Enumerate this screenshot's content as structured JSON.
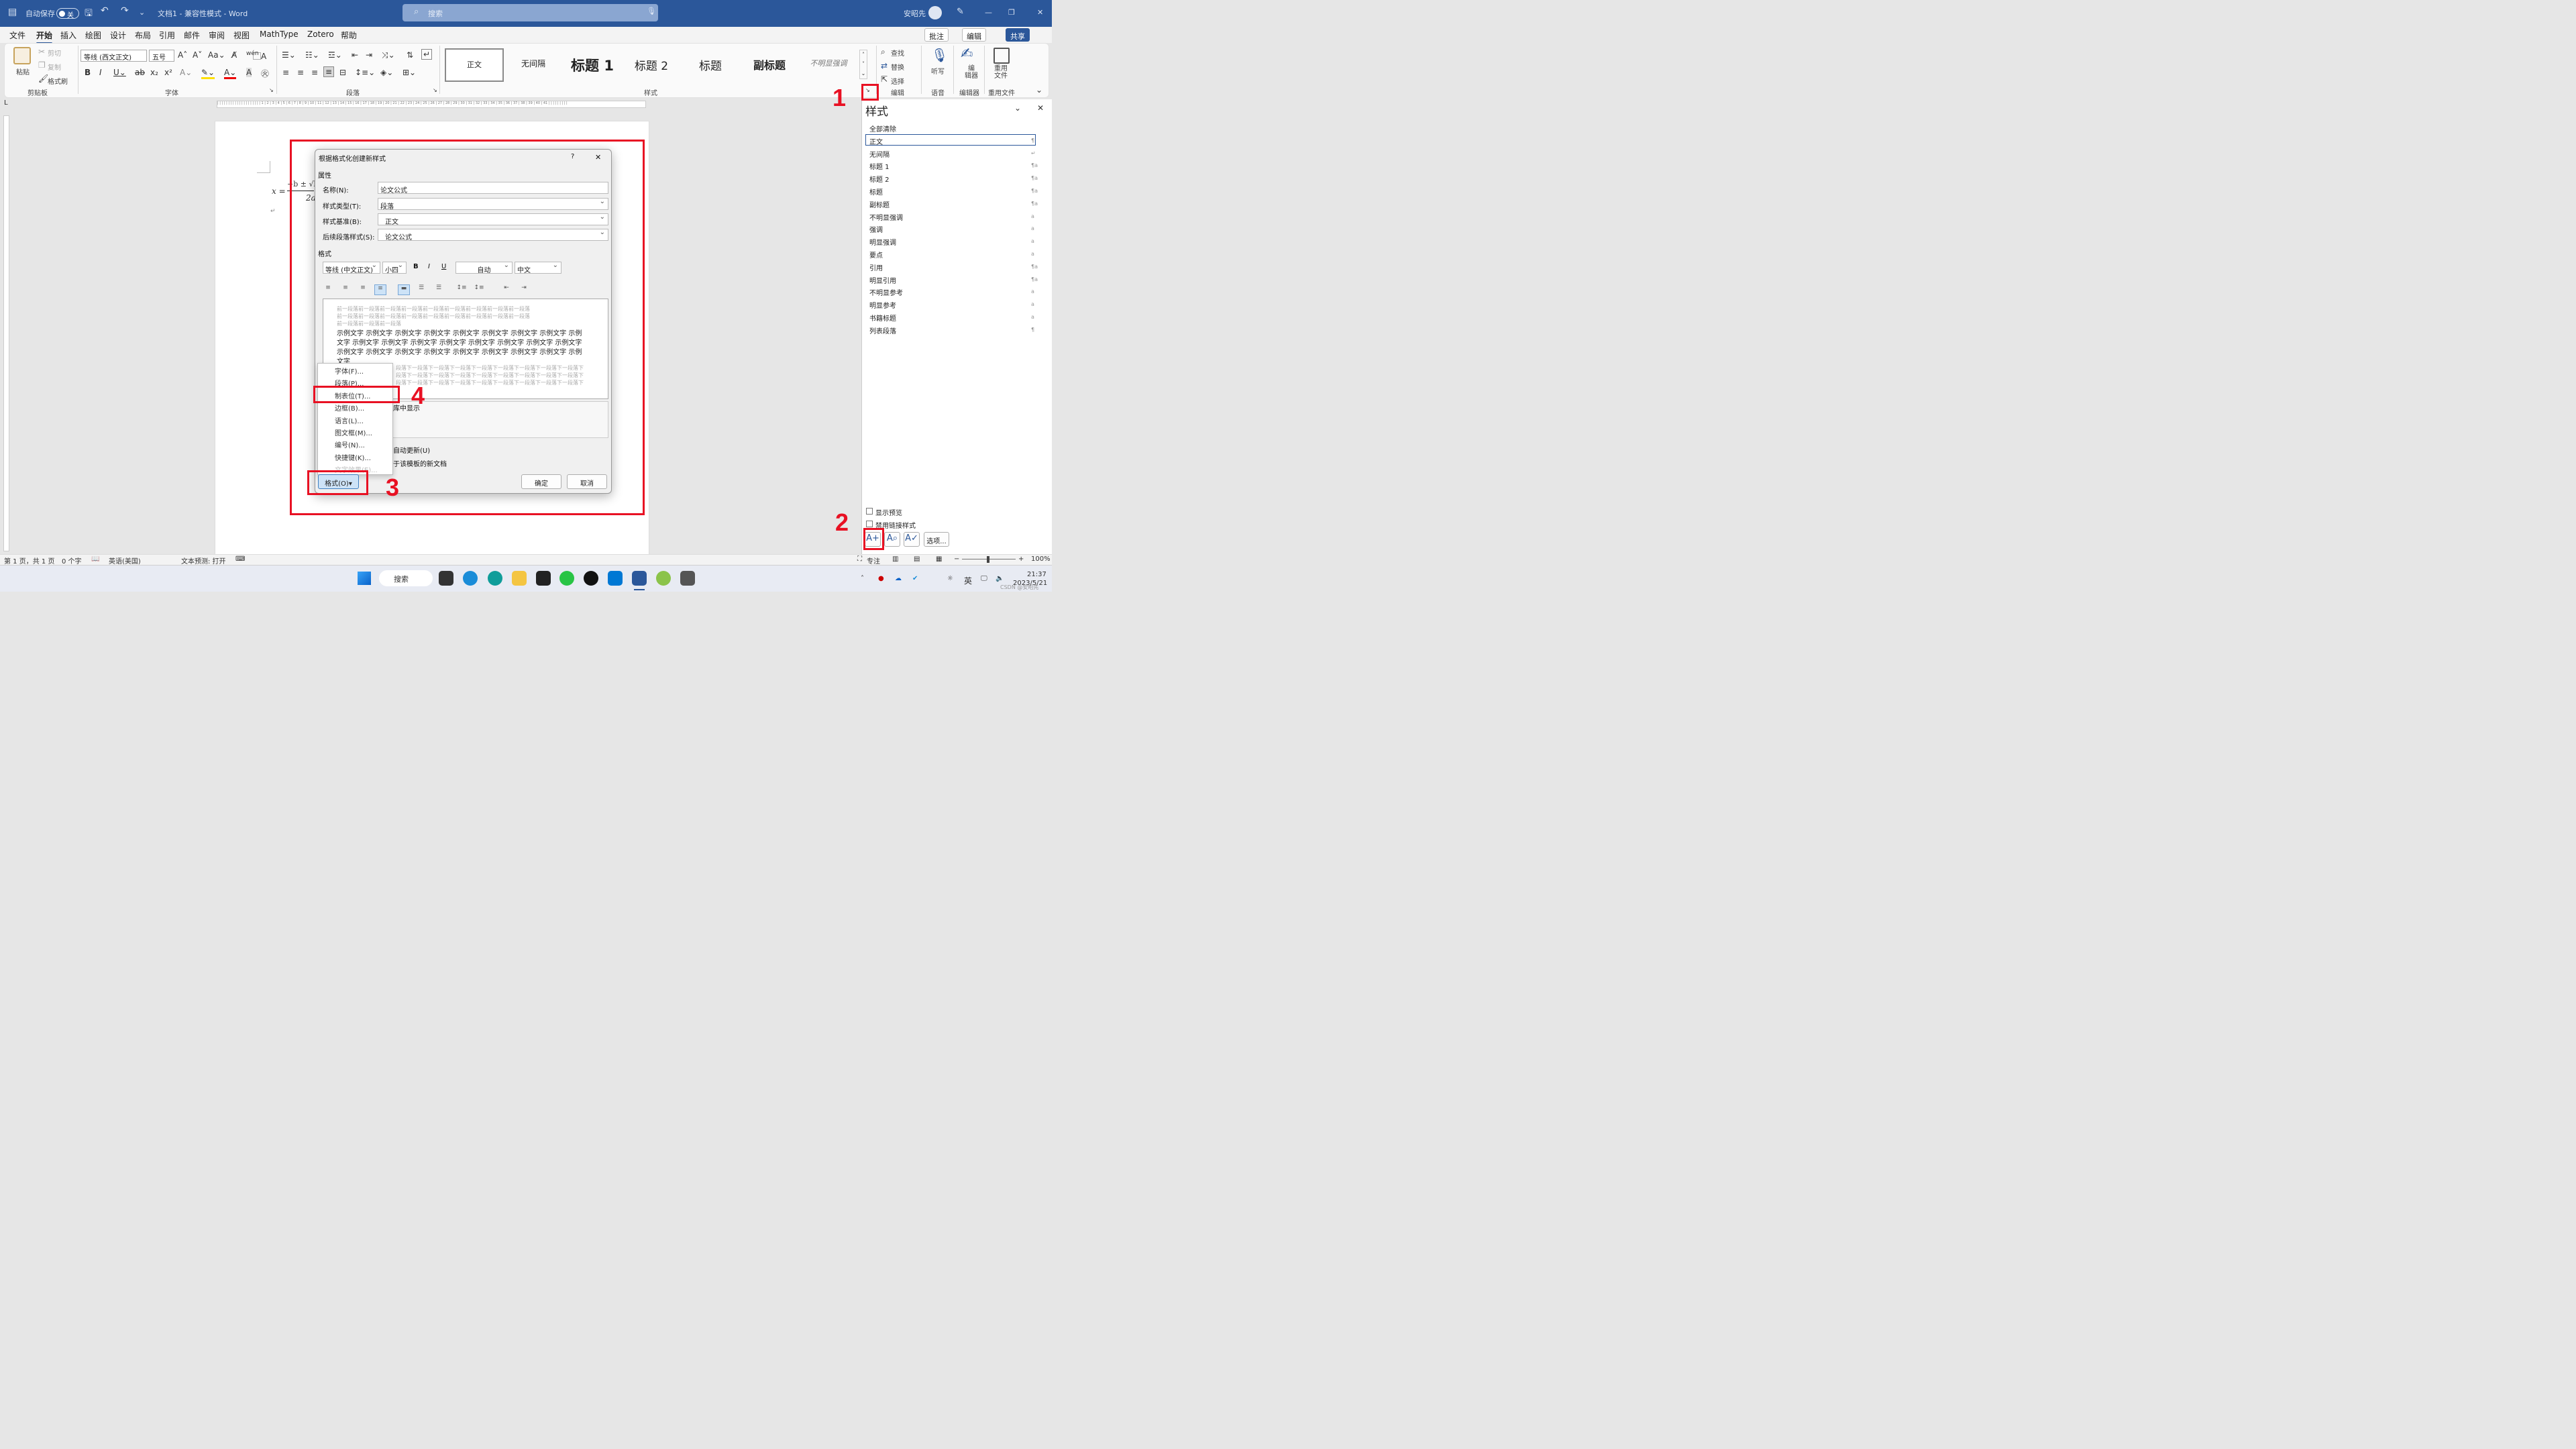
{
  "titlebar": {
    "autosave": "自动保存",
    "toggle": "关",
    "doc": "文档1  -  兼容性模式  -  Word",
    "search_placeholder": "搜索",
    "user": "安昭先"
  },
  "menu": {
    "items": [
      "文件",
      "开始",
      "插入",
      "绘图",
      "设计",
      "布局",
      "引用",
      "邮件",
      "审阅",
      "视图",
      "MathType",
      "Zotero",
      "帮助"
    ],
    "comment": "批注",
    "edit": "编辑",
    "share": "共享"
  },
  "ribbon": {
    "clipboard": {
      "paste": "粘贴",
      "cut": "剪切",
      "copy": "复制",
      "painter": "格式刷",
      "group": "剪贴板"
    },
    "font": {
      "name": "等线 (西文正文)",
      "size": "五号",
      "group": "字体"
    },
    "paragraph": {
      "group": "段落"
    },
    "styles": {
      "items": [
        "正文",
        "无间隔",
        "标题 1",
        "标题 2",
        "标题",
        "副标题",
        "不明显强调"
      ],
      "group": "样式"
    },
    "editing": {
      "find": "查找",
      "replace": "替换",
      "select": "选择",
      "group": "编辑"
    },
    "voice": {
      "dictate": "听写",
      "group": "语音"
    },
    "editor": {
      "label": "编\n辑器",
      "group": "编辑器"
    },
    "reuse": {
      "label": "重用\n文件",
      "group": "重用文件"
    }
  },
  "doc": {
    "formula": "x =",
    "formula_frac": "−b ± √b",
    "formula_den": "2a"
  },
  "dialog": {
    "title": "根据格式化创建新样式",
    "help": "?",
    "close": "✕",
    "props_header": "属性",
    "name_label": "名称(N):",
    "name_value": "论文公式",
    "type_label": "样式类型(T):",
    "type_value": "段落",
    "base_label": "样式基准(B):",
    "base_value": "正文",
    "next_label": "后续段落样式(S):",
    "next_value": "论文公式",
    "format_header": "格式",
    "font": "等线 (中文正文)",
    "size": "小四",
    "bold": "B",
    "italic": "I",
    "underline": "U",
    "color": "自动",
    "lang": "中文",
    "preview_prev": [
      "前一段落前一段落前一段落前一段落前一段落前一段落前一段落前一段落前一段落",
      "前一段落前一段落前一段落前一段落前一段落前一段落前一段落前一段落前一段落",
      "前一段落前一段落前一段落"
    ],
    "preview_sample": [
      "示例文字 示例文字 示例文字 示例文字 示例文字 示例文字 示例文字 示例文字 示例",
      "文字 示例文字 示例文字 示例文字 示例文字 示例文字 示例文字 示例文字 示例文字",
      "示例文字 示例文字 示例文字 示例文字 示例文字 示例文字 示例文字 示例文字 示例",
      "文字"
    ],
    "preview_next": [
      "段落下一段落下一段落下一段落下一段落下一段落下一段落下一段落下一段落下",
      "段落下一段落下一段落下一段落下一段落下一段落下一段落下一段落下一段落下",
      "段落下一段落下一段落下一段落下一段落下一段落下一段落下一段落下一段落下"
    ],
    "gallery_text": "库中显示",
    "auto_update": "自动更新(U)",
    "template_docs": "于该模板的新文档",
    "format_btn": "格式(O)",
    "ok": "确定",
    "cancel": "取消",
    "menu_items": [
      "字体(F)...",
      "段落(P)...",
      "制表位(T)...",
      "边框(B)...",
      "语言(L)...",
      "图文框(M)...",
      "编号(N)...",
      "快捷键(K)...",
      "文字效果(E)..."
    ]
  },
  "pane": {
    "title": "样式",
    "items": [
      "全部清除",
      "正文",
      "无间隔",
      "标题 1",
      "标题 2",
      "标题",
      "副标题",
      "不明显强调",
      "强调",
      "明显强调",
      "要点",
      "引用",
      "明显引用",
      "不明显参考",
      "明显参考",
      "书籍标题",
      "列表段落"
    ],
    "marks": [
      "¶",
      "↵",
      "¶a",
      "¶a",
      "¶a",
      "¶a",
      "a",
      "a",
      "a",
      "a",
      "¶a",
      "¶a",
      "a",
      "a",
      "a",
      "¶"
    ],
    "show_preview": "显示预览",
    "disable_linked": "禁用链接样式",
    "options": "选项..."
  },
  "status": {
    "page": "第 1 页，共 1 页",
    "words": "0 个字",
    "lang": "英语(美国)",
    "predict": "文本预测: 打开",
    "focus": "专注",
    "zoom": "100%"
  },
  "taskbar": {
    "search": "搜索",
    "ime": "英",
    "time": "21:37",
    "date": "2023/5/21",
    "watermark": "CSDN @安昭先"
  },
  "annotations": [
    "1",
    "2",
    "3",
    "4"
  ]
}
